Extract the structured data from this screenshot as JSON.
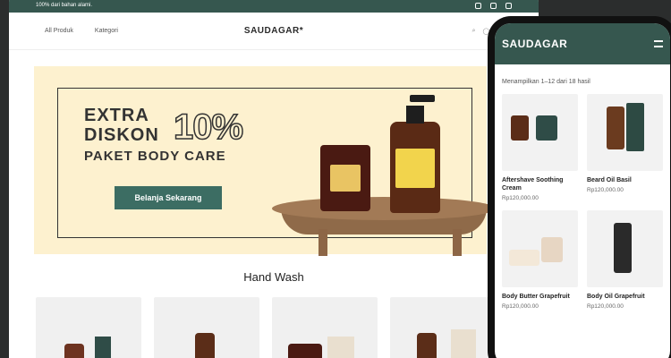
{
  "desktop": {
    "topbar_text": "100% dari bahan alami.",
    "nav_links": [
      "All Produk",
      "Kategori"
    ],
    "brand": "SAUDAGAR*",
    "hero": {
      "line1": "EXTRA",
      "line2": "DISKON",
      "percent": "10%",
      "line3": "PAKET BODY CARE",
      "cta": "Belanja Sekarang"
    },
    "section_title": "Hand Wash"
  },
  "phone": {
    "logo": "SAUDAGAR",
    "showing": "Menampilkan 1–12 dari 18 hasil",
    "products": [
      {
        "name": "Aftershave Soothing Cream",
        "price": "Rp120,000.00"
      },
      {
        "name": "Beard Oil Basil",
        "price": "Rp120,000.00"
      },
      {
        "name": "Body Butter Grapefruit",
        "price": "Rp120,000.00"
      },
      {
        "name": "Body Oil Grapefruit",
        "price": "Rp120,000.00"
      }
    ]
  }
}
